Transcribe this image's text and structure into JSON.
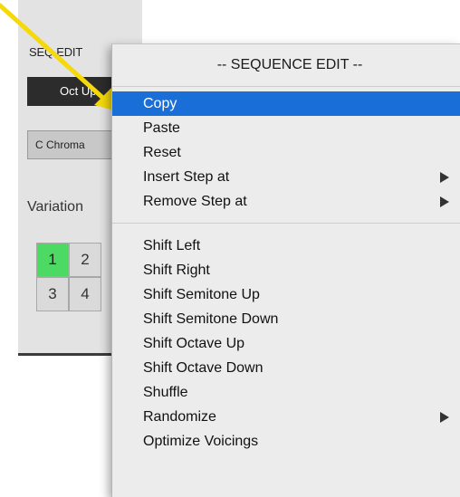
{
  "panel": {
    "title": "SEQ EDIT",
    "dark_button_label": "Oct Up",
    "scale_select_value": "C Chroma",
    "variation_label": "Variation",
    "variations": [
      "1",
      "2",
      "3",
      "4"
    ],
    "active_variation": "1"
  },
  "menu": {
    "header": "-- SEQUENCE EDIT --",
    "group1": [
      {
        "label": "Copy",
        "highlighted": true,
        "submenu": false
      },
      {
        "label": "Paste",
        "highlighted": false,
        "submenu": false
      },
      {
        "label": "Reset",
        "highlighted": false,
        "submenu": false
      },
      {
        "label": "Insert Step at",
        "highlighted": false,
        "submenu": true
      },
      {
        "label": "Remove Step at",
        "highlighted": false,
        "submenu": true
      }
    ],
    "group2": [
      {
        "label": "Shift Left",
        "highlighted": false,
        "submenu": false
      },
      {
        "label": "Shift Right",
        "highlighted": false,
        "submenu": false
      },
      {
        "label": "Shift Semitone Up",
        "highlighted": false,
        "submenu": false
      },
      {
        "label": "Shift Semitone Down",
        "highlighted": false,
        "submenu": false
      },
      {
        "label": "Shift Octave Up",
        "highlighted": false,
        "submenu": false
      },
      {
        "label": "Shift Octave Down",
        "highlighted": false,
        "submenu": false
      },
      {
        "label": "Shuffle",
        "highlighted": false,
        "submenu": false
      },
      {
        "label": "Randomize",
        "highlighted": false,
        "submenu": true
      },
      {
        "label": "Optimize Voicings",
        "highlighted": false,
        "submenu": false
      }
    ]
  },
  "colors": {
    "highlight": "#1a6ed8",
    "active_variation": "#4cd964",
    "annotation_arrow": "#f5d90a"
  },
  "icons": {
    "annotation": "annotation-arrow-icon",
    "submenu": "chevron-right-icon"
  }
}
